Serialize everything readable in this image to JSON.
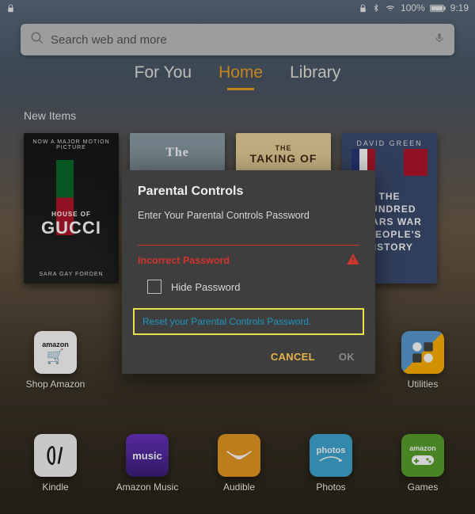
{
  "status": {
    "battery_pct": "100%",
    "time": "9:19"
  },
  "search": {
    "placeholder": "Search web and more"
  },
  "tabs": {
    "for_you": "For You",
    "home": "Home",
    "library": "Library"
  },
  "section_label": "New Items",
  "books": {
    "b1": {
      "topline": "NOW A MAJOR MOTION PICTURE",
      "pretitle": "HOUSE OF",
      "title": "GUCCI",
      "author": "SARA GAY FORDEN"
    },
    "b2": {
      "title": "The"
    },
    "b3": {
      "topline": "THE",
      "title": "TAKING OF"
    },
    "b4": {
      "author": "DAVID GREEN",
      "l1": "THE",
      "l2": "HUNDRED",
      "l3": "YEARS WAR",
      "l4": "A PEOPLE'S",
      "l5": "HISTORY"
    }
  },
  "dock": {
    "shop_amazon": "Shop Amazon",
    "utilities": "Utilities",
    "kindle": "Kindle",
    "amazon_music": "Amazon Music",
    "audible": "Audible",
    "photos": "Photos",
    "games": "Games",
    "music_word": "music",
    "photos_word": "photos",
    "amazon_word": "amazon"
  },
  "dialog": {
    "title": "Parental Controls",
    "subtitle": "Enter Your Parental Controls Password",
    "error": "Incorrect Password",
    "hide_pw": "Hide Password",
    "reset_link": "Reset your Parental Controls Password.",
    "cancel": "CANCEL",
    "ok": "OK"
  }
}
